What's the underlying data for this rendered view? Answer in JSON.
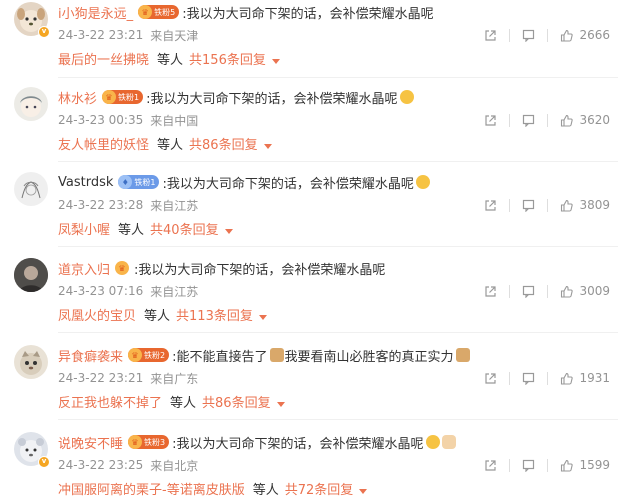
{
  "comments": [
    {
      "username": "i小狗是永远_",
      "badge": "铁粉5",
      "badge_style": "orange",
      "content": ":我以为大司命下架的话，会补偿荣耀水晶呢",
      "emoji": "",
      "time": "24-3-22 23:21",
      "location": "来自天津",
      "likes": "2666",
      "reply_name": "最后的一丝拂晓",
      "reply_etc": "等人",
      "reply_total": "共156条回复"
    },
    {
      "username": "林水衫",
      "badge": "铁粉1",
      "badge_style": "orange",
      "content": ":我以为大司命下架的话，会补偿荣耀水晶呢",
      "emoji": "cry-face",
      "time": "24-3-23 00:35",
      "location": "来自中国",
      "likes": "3620",
      "reply_name": "友人帐里的妖怪",
      "reply_etc": "等人",
      "reply_total": "共86条回复"
    },
    {
      "username": "Vastrdsk",
      "badge": "铁粉1",
      "badge_style": "blue",
      "content": ":我以为大司命下架的话，会补偿荣耀水晶呢",
      "emoji": "shocked-face",
      "time": "24-3-22 23:28",
      "location": "来自江苏",
      "likes": "3809",
      "reply_name": "凤梨小喔",
      "reply_etc": "等人",
      "reply_total": "共40条回复"
    },
    {
      "username": "道京入归",
      "badge": "",
      "badge_style": "small",
      "content": ":我以为大司命下架的话，会补偿荣耀水晶呢",
      "emoji": "",
      "time": "24-3-23 07:16",
      "location": "来自江苏",
      "likes": "3009",
      "reply_name": "凤凰火的宝贝",
      "reply_etc": "等人",
      "reply_total": "共113条回复"
    },
    {
      "username": "异食癖袭来",
      "badge": "铁粉2",
      "badge_style": "orange",
      "content": ":能不能直接告了",
      "content2": "我要看南山必胜客的真正实力",
      "emoji": "",
      "time": "24-3-22 23:21",
      "location": "来自广东",
      "likes": "1931",
      "reply_name": "反正我也躲不掉了",
      "reply_etc": "等人",
      "reply_total": "共86条回复"
    },
    {
      "username": "说晚安不睡",
      "badge": "铁粉3",
      "badge_style": "orange",
      "content": ":我以为大司命下架的话，会补偿荣耀水晶呢",
      "emoji": "laugh-cry-face",
      "time": "24-3-22 23:25",
      "location": "来自北京",
      "likes": "1599",
      "reply_name": "冲国服阿离的栗子-等诺离皮肤版",
      "reply_etc": "等人",
      "reply_total": "共72条回复"
    }
  ],
  "colors": {
    "accent": "#eb7350",
    "meta": "#939393",
    "badge_orange": "#e8672f",
    "badge_blue": "#6b9ae8"
  }
}
